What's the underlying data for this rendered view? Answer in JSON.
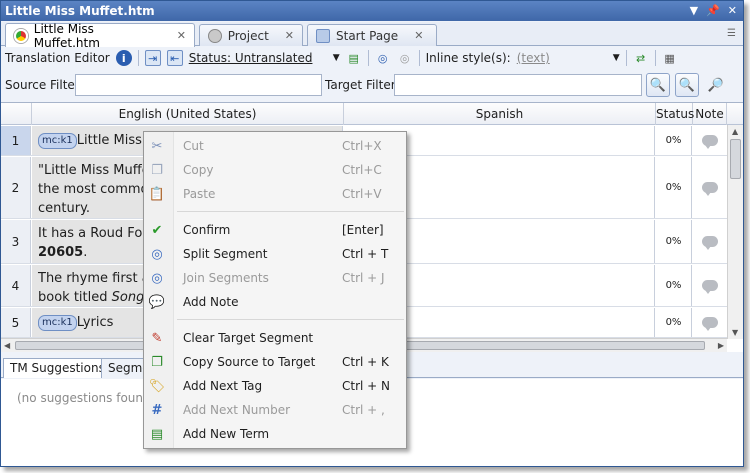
{
  "window": {
    "title": "Little Miss Muffet.htm"
  },
  "doc_tabs": [
    {
      "label": "Little Miss Muffet.htm",
      "active": true
    },
    {
      "label": "Project",
      "active": false
    },
    {
      "label": "Start Page",
      "active": false
    }
  ],
  "toolbar": {
    "translation_editor_label": "Translation Editor",
    "status_label": "Status: Untranslated",
    "inline_style_label": "Inline style(s):",
    "inline_style_value": "(text)"
  },
  "filters": {
    "source_label": "Source Filter:",
    "target_label": "Target Filter:"
  },
  "grid": {
    "columns": [
      "English (United States)",
      "Spanish",
      "Status",
      "Note"
    ],
    "rows": [
      {
        "num": "1",
        "tag": "mc:k1",
        "source": "Little Miss Muff",
        "status": "0%"
      },
      {
        "num": "2",
        "source": "\"Little Miss Muffe... the most commo... century.",
        "status": "0%"
      },
      {
        "num": "3",
        "source_a": "It has a Roud Fo",
        "source_b": "20605",
        "source_c": ".",
        "status": "0%"
      },
      {
        "num": "4",
        "source_a": "The rhyme first a",
        "source_b": "book titled ",
        "source_c": "Songs",
        "status": "0%"
      },
      {
        "num": "5",
        "tag": "mc:k1",
        "source": "Lyrics",
        "status": "0%"
      }
    ],
    "row2_lines": [
      "\"Little Miss Muffe",
      "the most commo",
      "century."
    ]
  },
  "lower_tabs": [
    {
      "label": "TM Suggestions",
      "active": true
    },
    {
      "label": "Segmen",
      "active": false
    }
  ],
  "suggestions": {
    "empty_text": "(no suggestions found)"
  },
  "context_menu": {
    "items": [
      {
        "label": "Cut",
        "shortcut": "Ctrl+X",
        "enabled": false,
        "icon": "scissors-icon"
      },
      {
        "label": "Copy",
        "shortcut": "Ctrl+C",
        "enabled": false,
        "icon": "copy-icon"
      },
      {
        "label": "Paste",
        "shortcut": "Ctrl+V",
        "enabled": false,
        "icon": "paste-icon"
      },
      {
        "label": "Confirm",
        "shortcut": "[Enter]",
        "enabled": true,
        "icon": "checkmark-icon"
      },
      {
        "label": "Split Segment",
        "shortcut": "Ctrl + T",
        "enabled": true,
        "icon": "split-icon"
      },
      {
        "label": "Join Segments",
        "shortcut": "Ctrl + J",
        "enabled": false,
        "icon": "join-icon"
      },
      {
        "label": "Add Note",
        "shortcut": "",
        "enabled": true,
        "icon": "note-icon"
      },
      {
        "label": "Clear Target Segment",
        "shortcut": "",
        "enabled": true,
        "icon": "eraser-icon"
      },
      {
        "label": "Copy Source to Target",
        "shortcut": "Ctrl + K",
        "enabled": true,
        "icon": "copy-source-icon"
      },
      {
        "label": "Add Next Tag",
        "shortcut": "Ctrl + N",
        "enabled": true,
        "icon": "tag-icon"
      },
      {
        "label": "Add Next Number",
        "shortcut": "Ctrl + ,",
        "enabled": false,
        "icon": "number-icon"
      },
      {
        "label": "Add New Term",
        "shortcut": "",
        "enabled": true,
        "icon": "term-icon"
      }
    ]
  }
}
